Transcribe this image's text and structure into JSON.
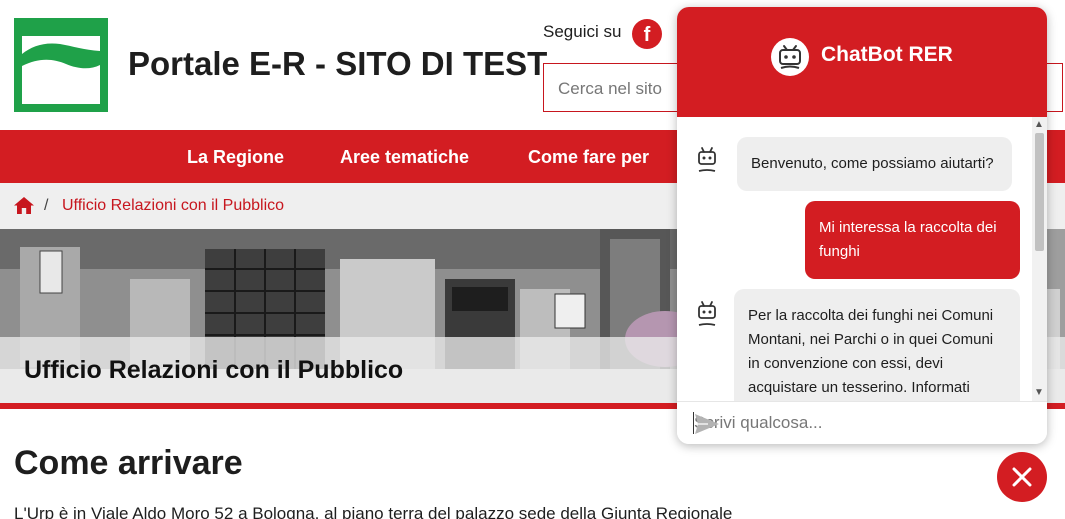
{
  "header": {
    "site_title": "Portale E-R - SITO DI TEST",
    "follow_label": "Seguici su",
    "social_icons": [
      "facebook-icon"
    ],
    "search_placeholder": "Cerca nel sito"
  },
  "nav": {
    "items": [
      {
        "label": "La Regione"
      },
      {
        "label": "Aree tematiche"
      },
      {
        "label": "Come fare per"
      }
    ]
  },
  "breadcrumb": {
    "home_icon": "home-icon",
    "separator": "/",
    "current": "Ufficio Relazioni con il Pubblico"
  },
  "hero": {
    "title": "Ufficio Relazioni con il Pubblico"
  },
  "content": {
    "heading": "Come arrivare",
    "paragraph": "L'Urp è in Viale Aldo Moro 52 a Bologna, al piano terra del palazzo sede della Giunta Regionale"
  },
  "chatbot": {
    "title": "ChatBot RER",
    "messages": [
      {
        "from": "bot",
        "lines": [
          "Benvenuto, come possiamo aiutarti?"
        ]
      },
      {
        "from": "user",
        "lines": [
          "Mi interessa la raccolta dei",
          "funghi"
        ]
      },
      {
        "from": "bot",
        "lines": [
          "Per la raccolta dei funghi nei Comuni",
          "Montani, nei Parchi o in quei Comuni",
          "in convenzione con essi, devi",
          "acquistare un tesserino.  Informati"
        ]
      }
    ],
    "input_placeholder": "Scrivi qualcosa..."
  },
  "colors": {
    "brand_red": "#d31d22",
    "brand_green": "#1fa149"
  }
}
